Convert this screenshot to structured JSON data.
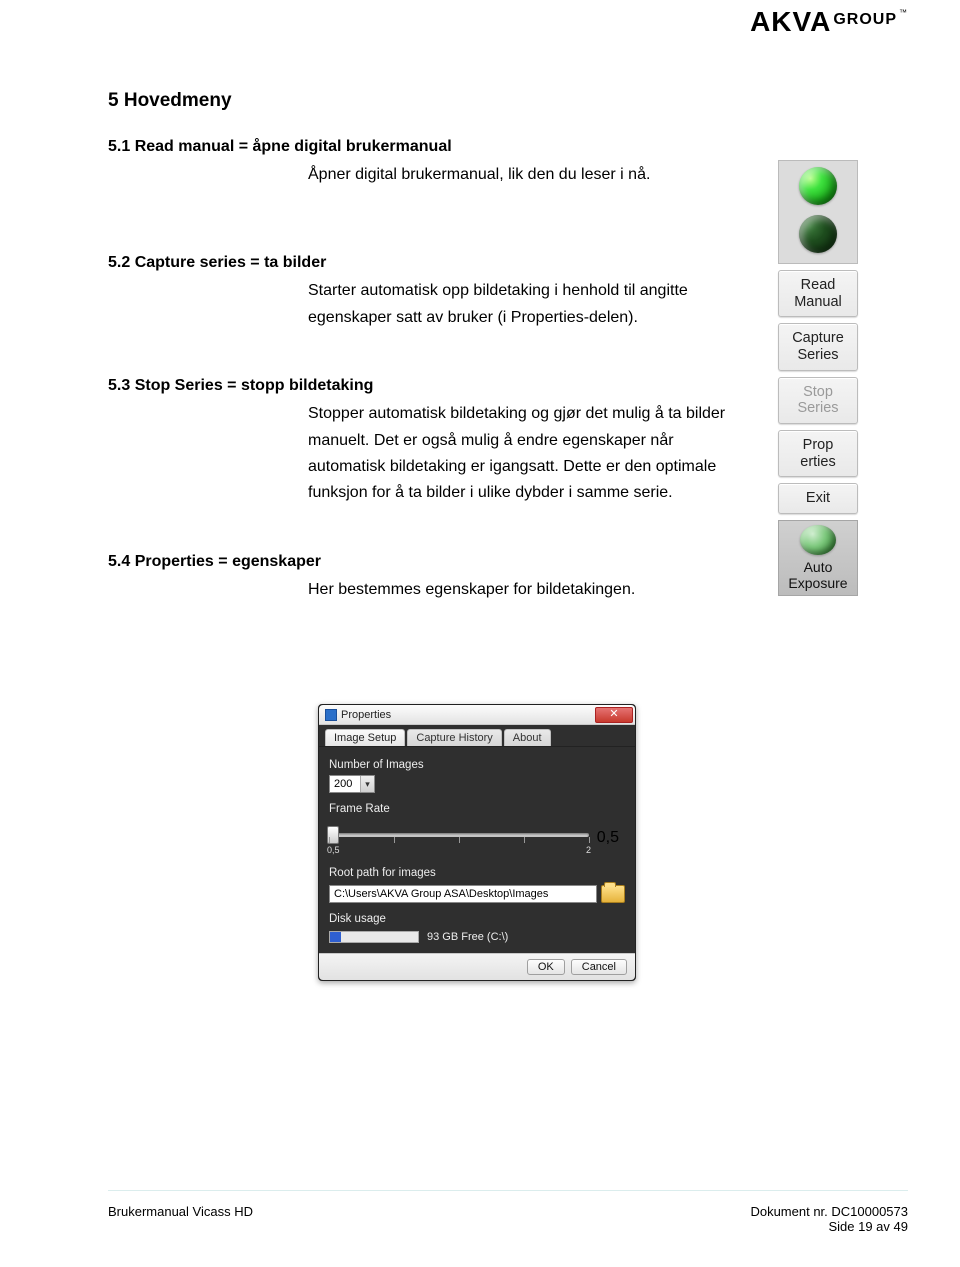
{
  "logo": {
    "brand": "AKVA",
    "sub": "GROUP",
    "tm": "™"
  },
  "panel": {
    "read_manual": "Read\nManual",
    "capture_series": "Capture\nSeries",
    "stop_series": "Stop\nSeries",
    "properties": "Prop\nerties",
    "exit": "Exit",
    "auto_exposure": "Auto\nExposure"
  },
  "sections": {
    "chapter": "5 Hovedmeny",
    "s1_title": "5.1 Read manual = åpne digital brukermanual",
    "s1_body": "Åpner digital brukermanual, lik den du leser i nå.",
    "s2_title": "5.2 Capture series = ta bilder",
    "s2_body": "Starter automatisk opp bildetaking i henhold til angitte egenskaper satt av bruker (i Properties-delen).",
    "s3_title": "5.3 Stop Series = stopp bildetaking",
    "s3_body": "Stopper automatisk bildetaking og gjør det mulig å ta bilder manuelt. Det er også mulig å endre egenskaper når automatisk bildetaking er igangsatt. Dette er den optimale funksjon for å ta bilder i ulike dybder i samme serie.",
    "s4_title": "5.4 Properties = egenskaper",
    "s4_body": "Her bestemmes egenskaper for bildetakingen."
  },
  "properties_dialog": {
    "title": "Properties",
    "tabs": {
      "image_setup": "Image Setup",
      "capture_history": "Capture History",
      "about": "About"
    },
    "number_of_images_label": "Number of Images",
    "number_of_images_value": "200",
    "frame_rate_label": "Frame Rate",
    "frame_rate_scale_lo": "0,5",
    "frame_rate_scale_hi": "2",
    "frame_rate_readout": "0,5",
    "root_path_label": "Root path for images",
    "root_path_value": "C:\\Users\\AKVA Group ASA\\Desktop\\Images",
    "disk_usage_label": "Disk usage",
    "disk_free_text": "93 GB Free (C:\\)",
    "ok": "OK",
    "cancel": "Cancel",
    "close_glyph": "✕"
  },
  "footer": {
    "left": "Brukermanual Vicass HD",
    "right_doc": "Dokument nr. DC10000573",
    "right_page": "Side 19 av 49"
  }
}
